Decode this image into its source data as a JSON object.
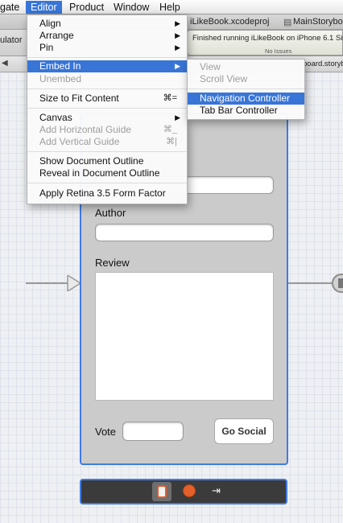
{
  "menubar": {
    "items": [
      "gate",
      "Editor",
      "Product",
      "Window",
      "Help"
    ]
  },
  "toolbar": {
    "tab_project": "iLikeBook.xcodeproj",
    "tab_storyboard": "MainStoryboard",
    "scheme": "ulator",
    "status": "Finished running iLikeBook on iPhone 6.1 Si",
    "issues": "No Issues",
    "jump_file": "board.storyboard"
  },
  "editor_menu": {
    "align": "Align",
    "arrange": "Arrange",
    "pin": "Pin",
    "embed_in": "Embed In",
    "unembed": "Unembed",
    "size_to_fit": "Size to Fit Content",
    "size_to_fit_shortcut": "⌘=",
    "canvas": "Canvas",
    "add_horizontal_guide": "Add Horizontal Guide",
    "add_horizontal_guide_shortcut": "⌘_",
    "add_vertical_guide": "Add Vertical Guide",
    "add_vertical_guide_shortcut": "⌘|",
    "show_document_outline": "Show Document Outline",
    "reveal_in_document_outline": "Reveal in Document Outline",
    "apply_retina": "Apply Retina 3.5 Form Factor"
  },
  "embed_submenu": {
    "view": "View",
    "scroll_view": "Scroll View",
    "navigation_controller": "Navigation Controller",
    "tab_bar_controller": "Tab Bar Controller"
  },
  "scene": {
    "author_label": "Author",
    "review_label": "Review",
    "vote_label": "Vote",
    "go_social_label": "Go Social"
  },
  "dock": {
    "icons": [
      "view-controller-icon",
      "first-responder-icon",
      "exit-icon"
    ]
  },
  "colors": {
    "selection": "#3875d7",
    "scene_border": "#3f7be4",
    "scene_bg": "#cbcbcb"
  }
}
